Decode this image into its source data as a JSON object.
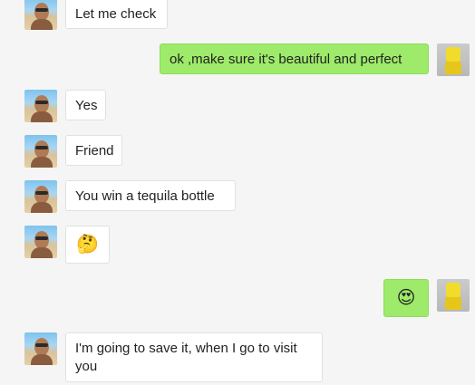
{
  "messages": [
    {
      "side": "left",
      "text": "Let me check"
    },
    {
      "side": "right",
      "text": "ok ,make sure it's  beautiful and perfect"
    },
    {
      "side": "left",
      "text": "Yes"
    },
    {
      "side": "left",
      "text": "Friend"
    },
    {
      "side": "left",
      "text": "You win a tequila bottle"
    },
    {
      "side": "left",
      "emoji": "🤔"
    },
    {
      "side": "right",
      "emoji": "😍"
    },
    {
      "side": "left",
      "text": "I'm going  to save it, when I go to visit you"
    }
  ]
}
